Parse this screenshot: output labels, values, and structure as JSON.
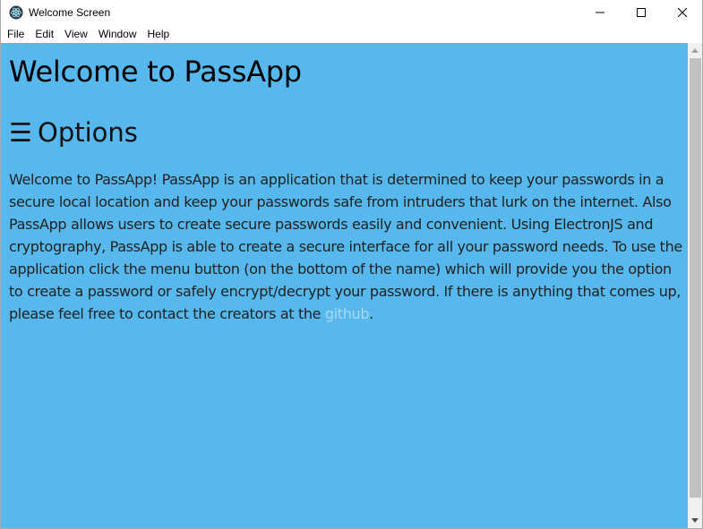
{
  "window": {
    "title": "Welcome Screen",
    "app_icon": "electron-atom-icon"
  },
  "menu": {
    "items": [
      {
        "label": "File"
      },
      {
        "label": "Edit"
      },
      {
        "label": "View"
      },
      {
        "label": "Window"
      },
      {
        "label": "Help"
      }
    ]
  },
  "content": {
    "heading": "Welcome to PassApp",
    "options_icon": "☰",
    "options_label": "Options",
    "body": "Welcome to PassApp! PassApp is an application that is determined to keep your passwords in a secure local location and keep your passwords safe from intruders that lurk on the internet. Also PassApp allows users to create secure passwords easily and convenient. Using ElectronJS and cryptography, PassApp is able to create a secure interface for all your password needs. To use the application click the menu button (on the bottom of the name) which will provide you the option to create a password or safely encrypt/decrypt your password. If there is anything that comes up, please feel free to contact the creators at the ",
    "link_label": "github",
    "body_end": "."
  },
  "colors": {
    "background": "#56b8ec",
    "link": "#a9d6f5",
    "scroll_thumb": "#c1c1c1"
  }
}
